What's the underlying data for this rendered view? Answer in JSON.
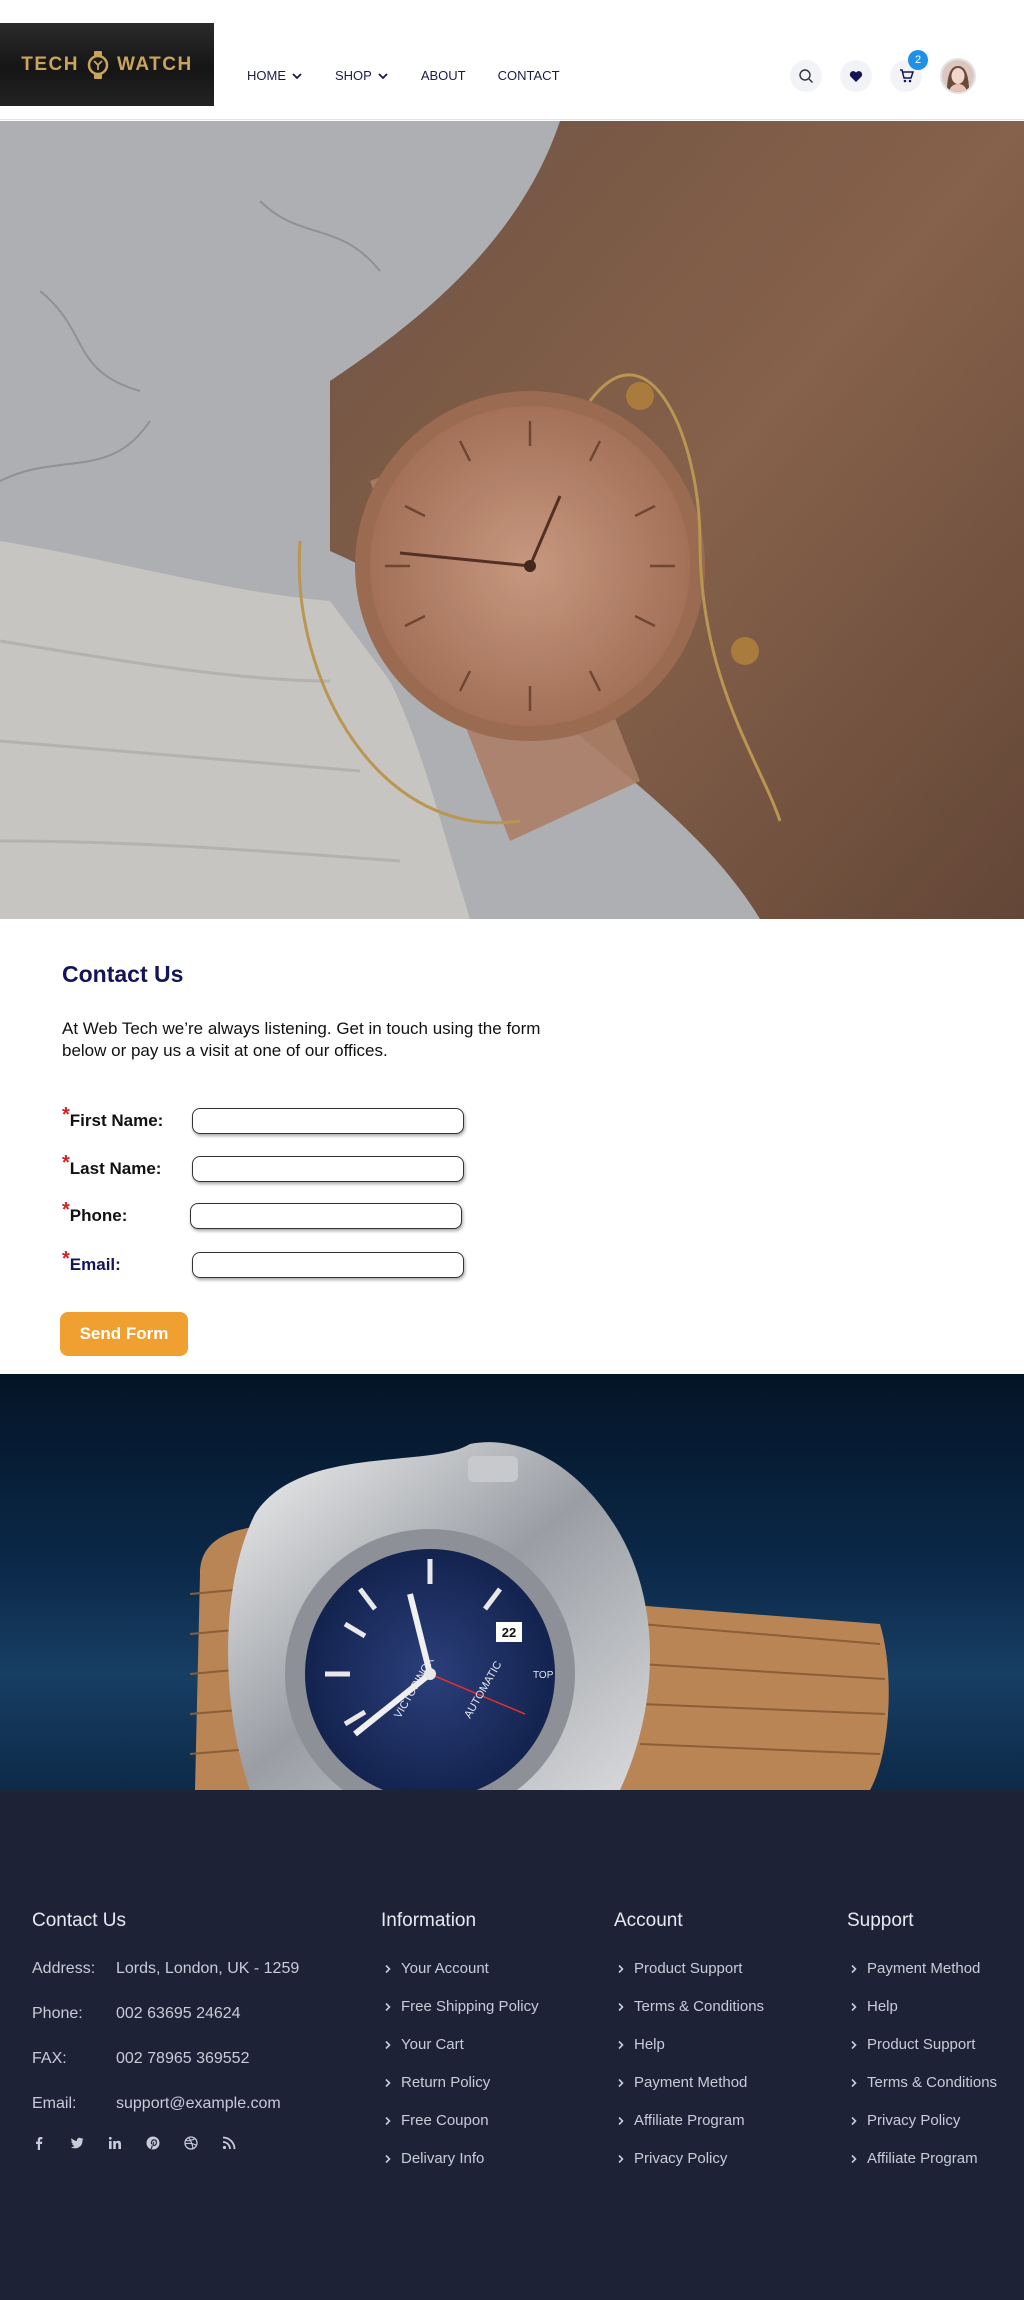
{
  "brand": {
    "logo_text_left": "TECH",
    "logo_text_right": "WATCH",
    "logo_gold": "#c9a45a"
  },
  "nav": {
    "items": [
      {
        "label": "HOME",
        "dropdown": true
      },
      {
        "label": "SHOP",
        "dropdown": true
      },
      {
        "label": "ABOUT",
        "dropdown": false
      },
      {
        "label": "CONTACT",
        "dropdown": false
      }
    ]
  },
  "header_icons": {
    "search": "search-icon",
    "wishlist": "heart-icon",
    "cart": "cart-icon",
    "cart_count": "2",
    "profile": "user-avatar"
  },
  "contact": {
    "title": "Contact Us",
    "intro": "At Web Tech we’re always listening. Get in touch using the form below or pay us a visit at one of our offices.",
    "fields": [
      {
        "label": "First Name:",
        "required": true,
        "value": ""
      },
      {
        "label": "Last Name:",
        "required": true,
        "value": ""
      },
      {
        "label": "Phone:",
        "required": true,
        "value": ""
      },
      {
        "label": "Email:",
        "required": true,
        "value": ""
      }
    ],
    "submit_label": "Send Form",
    "submit_color": "#f0a030"
  },
  "banner": {
    "dial_brand": "VICTORINOX",
    "dial_text": "AUTOMATIC",
    "dial_date": "22",
    "dial_top": "TOP"
  },
  "footer": {
    "contact_title": "Contact Us",
    "address_rows": [
      {
        "key": "Address:",
        "value": "Lords, London, UK - 1259"
      },
      {
        "key": "Phone:",
        "value": "002 63695 24624"
      },
      {
        "key": "FAX:",
        "value": "002 78965 369552"
      },
      {
        "key": "Email:",
        "value": "support@example.com"
      }
    ],
    "socials": [
      "facebook-icon",
      "twitter-icon",
      "linkedin-icon",
      "pinterest-icon",
      "dribbble-icon",
      "rss-icon"
    ],
    "columns": [
      {
        "title": "Information",
        "items": [
          "Your Account",
          "Free Shipping Policy",
          "Your Cart",
          "Return Policy",
          "Free Coupon",
          "Delivary Info"
        ]
      },
      {
        "title": "Account",
        "items": [
          "Product Support",
          "Terms & Conditions",
          "Help",
          "Payment Method",
          "Affiliate Program",
          "Privacy Policy"
        ]
      },
      {
        "title": "Support",
        "items": [
          "Payment Method",
          "Help",
          "Product Support",
          "Terms & Conditions",
          "Privacy Policy",
          "Affiliate Program"
        ]
      }
    ],
    "background": "#1d2237"
  }
}
